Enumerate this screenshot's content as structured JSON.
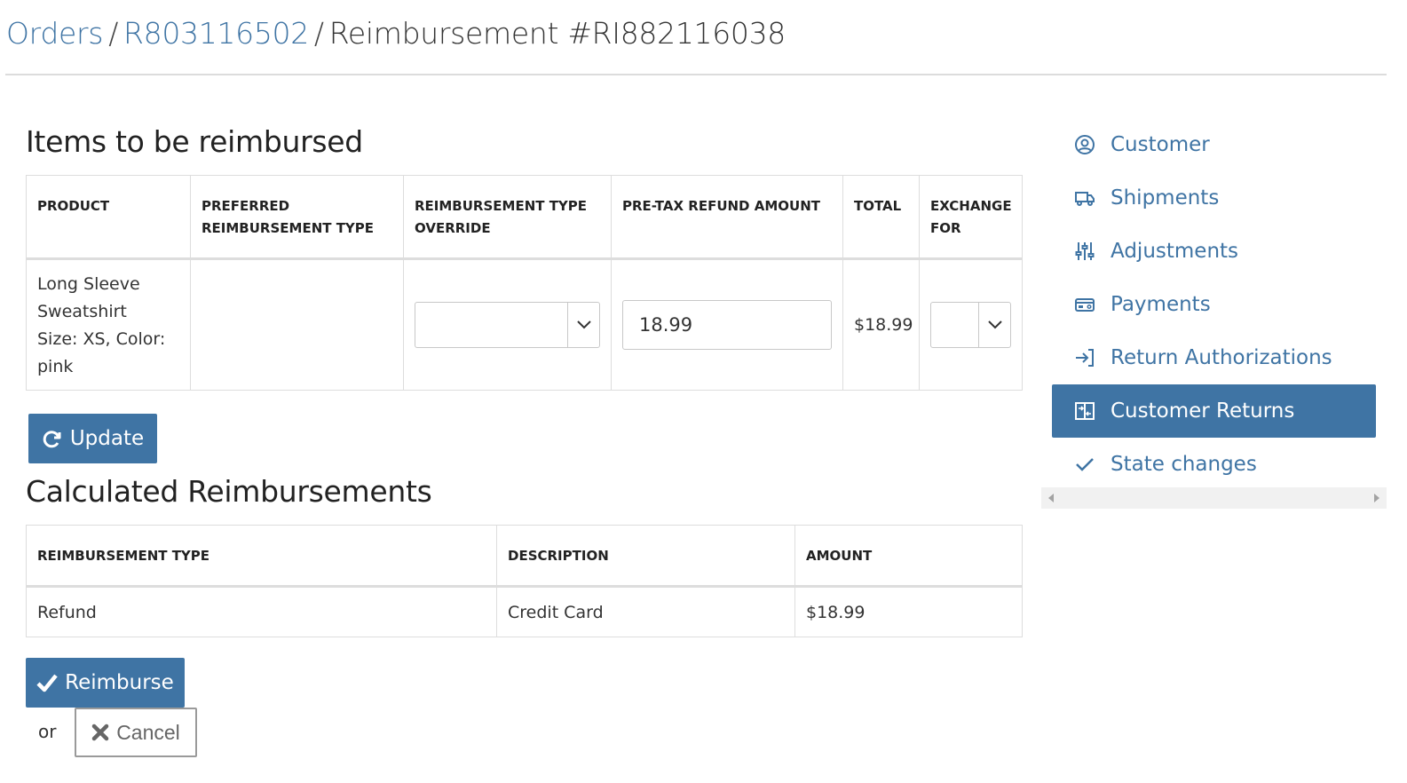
{
  "breadcrumb": {
    "orders": "Orders",
    "order_number": "R803116502",
    "current": "Reimbursement #RI882116038",
    "separator": "/"
  },
  "items_section": {
    "title": "Items to be reimbursed",
    "columns": [
      "PRODUCT",
      "PREFERRED REIMBURSEMENT TYPE",
      "REIMBURSEMENT TYPE OVERRIDE",
      "PRE-TAX REFUND AMOUNT",
      "TOTAL",
      "EXCHANGE FOR"
    ],
    "rows": [
      {
        "product_name": "Long Sleeve Sweatshirt",
        "product_variant": "Size: XS, Color: pink",
        "preferred_type": "",
        "override_selected": "",
        "pretax_amount": "18.99",
        "total": "$18.99",
        "exchange_selected": ""
      }
    ],
    "update_button": "Update"
  },
  "calculated_section": {
    "title": "Calculated Reimbursements",
    "columns": [
      "REIMBURSEMENT TYPE",
      "DESCRIPTION",
      "AMOUNT"
    ],
    "rows": [
      {
        "type": "Refund",
        "description": "Credit Card",
        "amount": "$18.99"
      }
    ]
  },
  "actions": {
    "reimburse_label": "Reimburse",
    "or_text": "or",
    "cancel_label": "Cancel"
  },
  "sidebar": {
    "items": [
      {
        "label": "Customer",
        "icon": "user-circle-icon",
        "active": false
      },
      {
        "label": "Shipments",
        "icon": "truck-icon",
        "active": false
      },
      {
        "label": "Adjustments",
        "icon": "sliders-icon",
        "active": false
      },
      {
        "label": "Payments",
        "icon": "credit-card-icon",
        "active": false
      },
      {
        "label": "Return Authorizations",
        "icon": "sign-in-icon",
        "active": false
      },
      {
        "label": "Customer Returns",
        "icon": "exchange-icon",
        "active": true
      },
      {
        "label": "State changes",
        "icon": "check-icon",
        "active": false
      }
    ]
  },
  "colors": {
    "accent": "#3f74a4",
    "border": "#dddddd"
  }
}
